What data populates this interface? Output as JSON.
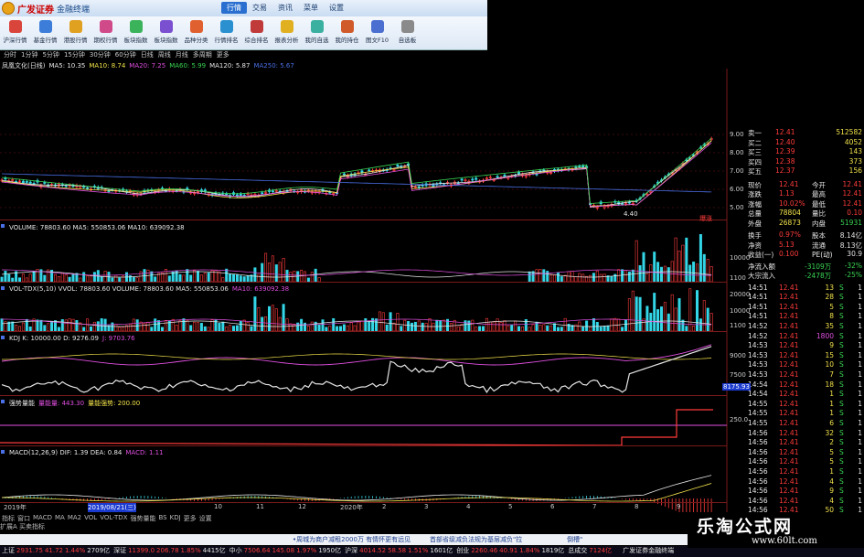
{
  "app": {
    "brand": "广发证券",
    "product": "金融终端",
    "top_menu": [
      "行情",
      "交易",
      "资讯",
      "菜单",
      "设置"
    ],
    "active_menu": 0
  },
  "toolbar": [
    {
      "label": "沪深行情",
      "color": "#d9453b"
    },
    {
      "label": "基金行情",
      "color": "#3b7dd9"
    },
    {
      "label": "港股行情",
      "color": "#e0a020"
    },
    {
      "label": "期权行情",
      "color": "#d04a8a"
    },
    {
      "label": "板块指数",
      "color": "#3bb35a"
    },
    {
      "label": "板块指数",
      "color": "#7a4fd0"
    },
    {
      "label": "品种分类",
      "color": "#e06030"
    },
    {
      "label": "行情排名",
      "color": "#2a90d0"
    },
    {
      "label": "综合排名",
      "color": "#c03a3a"
    },
    {
      "label": "报表分析",
      "color": "#e0b020"
    },
    {
      "label": "我的自选",
      "color": "#3ab0a0"
    },
    {
      "label": "我的持仓",
      "color": "#d05a2a"
    },
    {
      "label": "图文F10",
      "color": "#4a6fd0"
    },
    {
      "label": "自选板",
      "color": "#8a8a8a"
    }
  ],
  "periods": [
    "分时",
    "1分钟",
    "5分钟",
    "15分钟",
    "30分钟",
    "60分钟",
    "日线",
    "周线",
    "月线",
    "多周期",
    "更多"
  ],
  "main_legend": [
    {
      "text": "凤凰文化(日线)",
      "color": "#e6e6e6"
    },
    {
      "text": "MA5: 10.35",
      "color": "#e6e6e6"
    },
    {
      "text": "MA10: 8.74",
      "color": "#f2e24a"
    },
    {
      "text": "MA20: 7.25",
      "color": "#e04fe0"
    },
    {
      "text": "MA60: 5.99",
      "color": "#39d353"
    },
    {
      "text": "MA120: 5.87",
      "color": "#e6e6e6"
    },
    {
      "text": "MA250: 5.67",
      "color": "#4a6fe6"
    }
  ],
  "price_axis": [
    "9.00",
    "8.00",
    "7.00",
    "6.00",
    "5.00"
  ],
  "price_annotation": {
    "low": "4.40",
    "label": "爆涨"
  },
  "volume_legend": "VOLUME: 78803.60  MA5: 550853.06  MA10: 639092.38",
  "volume_axis": [
    "10000",
    "1100"
  ],
  "voltdx_legend": [
    {
      "text": "VOL-TDX(5,10)  VVOL: 78803.60  VOLUME: 78803.60  MA5: 550853.06",
      "color": "#e6e6e6"
    },
    {
      "text": "MA10: 639092.38",
      "color": "#e04fe0"
    }
  ],
  "voltdx_axis": [
    "20000",
    "10000",
    "1100"
  ],
  "kdj_legend": [
    {
      "text": "KDJ  K: 10000.00  D: 9276.09",
      "color": "#e6e6e6"
    },
    {
      "text": "J: 9703.76",
      "color": "#e04fe0"
    }
  ],
  "kdj_axis": [
    "9000",
    "7500"
  ],
  "kdj_value": "8175.93",
  "fund_legend": [
    {
      "text": "强势量能",
      "color": "#e6e6e6"
    },
    {
      "text": "量能量: 443.30",
      "color": "#e04fe0"
    },
    {
      "text": "量能强势: 200.00",
      "color": "#f2e24a"
    }
  ],
  "fund_axis": [
    "250.0"
  ],
  "macd_legend": [
    {
      "text": "MACD(12,26,9)  DIF: 1.39  DEA: 0.84",
      "color": "#e6e6e6"
    },
    {
      "text": "MACD: 1.11",
      "color": "#e04fe0"
    }
  ],
  "date_axis": [
    "2019年",
    "",
    "2019/08/21(三)",
    "",
    "",
    "10",
    "11",
    "12",
    "2020年",
    "2",
    "3",
    "4",
    "5",
    "6",
    "7",
    "8",
    "9"
  ],
  "tabs": [
    "指标",
    "窗口",
    "MACD",
    "MA",
    "MA2",
    "VOL",
    "VOL-TDX",
    "强势量能",
    "BS",
    "KDJ",
    "更多",
    "设置"
  ],
  "tabs2": "扩展A  买卖指标",
  "quote": {
    "asks": [
      {
        "label": "卖一",
        "price": "12.41",
        "vol": "512582"
      },
      {
        "label": "买二",
        "price": "12.40",
        "vol": "4052"
      },
      {
        "label": "买三",
        "price": "12.39",
        "vol": "143"
      },
      {
        "label": "买四",
        "price": "12.38",
        "vol": "373"
      },
      {
        "label": "买五",
        "price": "12.37",
        "vol": "156"
      }
    ],
    "stats": [
      {
        "l1": "现价",
        "v1": "12.41",
        "l2": "今开",
        "v2": "12.41"
      },
      {
        "l1": "涨跌",
        "v1": "1.13",
        "l2": "最高",
        "v2": "12.41"
      },
      {
        "l1": "涨幅",
        "v1": "10.02%",
        "l2": "最低",
        "v2": "12.41"
      },
      {
        "l1": "总量",
        "v1": "78804",
        "l2": "量比",
        "v2": "0.10"
      },
      {
        "l1": "外盘",
        "v1": "26873",
        "l2": "内盘",
        "v2": "51931"
      },
      {
        "l1": "换手",
        "v1": "0.97%",
        "l2": "股本",
        "v2": "8.14亿"
      },
      {
        "l1": "净资",
        "v1": "5.13",
        "l2": "流通",
        "v2": "8.13亿"
      },
      {
        "l1": "收益(一)",
        "v1": "0.100",
        "l2": "PE(动)",
        "v2": "30.9"
      }
    ],
    "flows": [
      {
        "label": "净流入额",
        "value": "-3109万",
        "pct": "-32%"
      },
      {
        "label": "大宗流入",
        "value": "-2478万",
        "pct": "-25%"
      }
    ],
    "ticks": [
      {
        "t": "14:51",
        "p": "12.41",
        "v": "13",
        "s": "S"
      },
      {
        "t": "14:51",
        "p": "12.41",
        "v": "28",
        "s": "S"
      },
      {
        "t": "14:51",
        "p": "12.41",
        "v": "5",
        "s": "S"
      },
      {
        "t": "14:51",
        "p": "12.41",
        "v": "8",
        "s": "S"
      },
      {
        "t": "14:52",
        "p": "12.41",
        "v": "35",
        "s": "S"
      },
      {
        "t": "14:52",
        "p": "12.41",
        "v": "1800",
        "s": "S"
      },
      {
        "t": "14:53",
        "p": "12.41",
        "v": "9",
        "s": "S"
      },
      {
        "t": "14:53",
        "p": "12.41",
        "v": "15",
        "s": "S"
      },
      {
        "t": "14:53",
        "p": "12.41",
        "v": "10",
        "s": "S"
      },
      {
        "t": "14:53",
        "p": "12.41",
        "v": "7",
        "s": "S"
      },
      {
        "t": "14:54",
        "p": "12.41",
        "v": "18",
        "s": "S"
      },
      {
        "t": "14:54",
        "p": "12.41",
        "v": "1",
        "s": "S"
      },
      {
        "t": "14:55",
        "p": "12.41",
        "v": "1",
        "s": "S"
      },
      {
        "t": "14:55",
        "p": "12.41",
        "v": "1",
        "s": "S"
      },
      {
        "t": "14:55",
        "p": "12.41",
        "v": "6",
        "s": "S"
      },
      {
        "t": "14:56",
        "p": "12.41",
        "v": "32",
        "s": "S"
      },
      {
        "t": "14:56",
        "p": "12.41",
        "v": "2",
        "s": "S"
      },
      {
        "t": "14:56",
        "p": "12.41",
        "v": "5",
        "s": "S"
      },
      {
        "t": "14:56",
        "p": "12.41",
        "v": "5",
        "s": "S"
      },
      {
        "t": "14:56",
        "p": "12.41",
        "v": "1",
        "s": "S"
      },
      {
        "t": "14:56",
        "p": "12.41",
        "v": "4",
        "s": "S"
      },
      {
        "t": "14:56",
        "p": "12.41",
        "v": "9",
        "s": "S"
      },
      {
        "t": "14:56",
        "p": "12.41",
        "v": "4",
        "s": "S"
      },
      {
        "t": "14:56",
        "p": "12.41",
        "v": "50",
        "s": "S"
      }
    ]
  },
  "news": [
    "•周城为商户减租2000万 有情怀更有远见",
    "首部省级减负法规为基层减负\"拉"
  ],
  "news2": "倒槽\"",
  "ticker": [
    {
      "name": "上证",
      "val": "2931.75",
      "chg": "41.72",
      "pct": "1.44%",
      "amt": "2709亿"
    },
    {
      "name": "深证",
      "val": "11399.0",
      "chg": "206.78",
      "pct": "1.85%",
      "amt": "4415亿"
    },
    {
      "name": "中小",
      "val": "7506.64",
      "chg": "145.08",
      "pct": "1.97%",
      "amt": "1950亿"
    },
    {
      "name": "沪深",
      "val": "4014.52",
      "chg": "58.58",
      "pct": "1.51%",
      "amt": "1601亿"
    },
    {
      "name": "创业",
      "val": "2260.46",
      "chg": "40.91",
      "pct": "1.84%",
      "amt": "1819亿"
    },
    {
      "name": "总成交",
      "val": "7124亿"
    }
  ],
  "ticker_brand": "广发证券金融终端",
  "watermark": {
    "title": "乐淘公式网",
    "url": "www.60lt.com"
  }
}
